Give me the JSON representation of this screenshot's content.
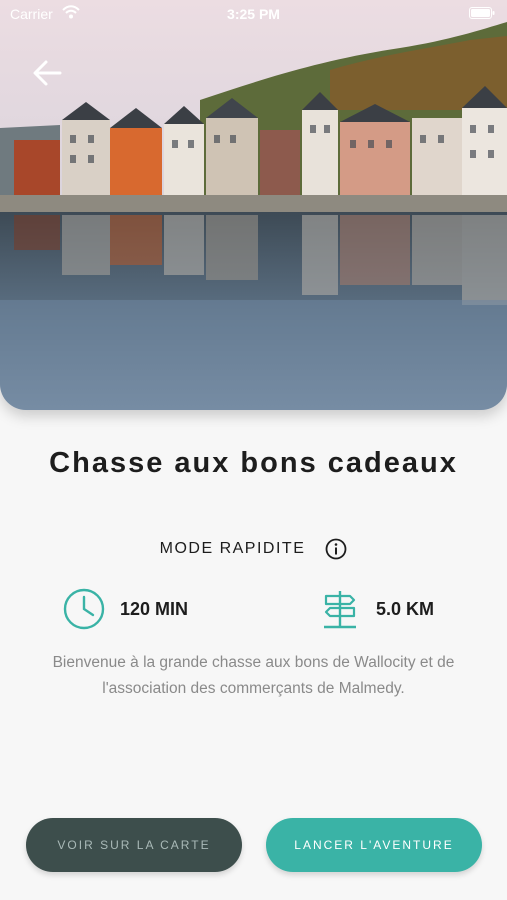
{
  "status_bar": {
    "carrier": "Carrier",
    "time": "3:25 PM"
  },
  "hero": {
    "image_description_icon": "town-riverside-photo"
  },
  "game": {
    "title": "Chasse aux bons cadeaux",
    "mode": "MODE RAPIDITE",
    "duration": "120 MIN",
    "distance": "5.0 KM",
    "description": "Bienvenue à la grande chasse aux bons de Wallocity et de l'association des commerçants de Malmedy."
  },
  "actions": {
    "map_label": "VOIR SUR LA CARTE",
    "start_label": "LANCER L'AVENTURE"
  },
  "colors": {
    "accent": "#3ab3a6",
    "dark_button": "#3d4e4c"
  }
}
